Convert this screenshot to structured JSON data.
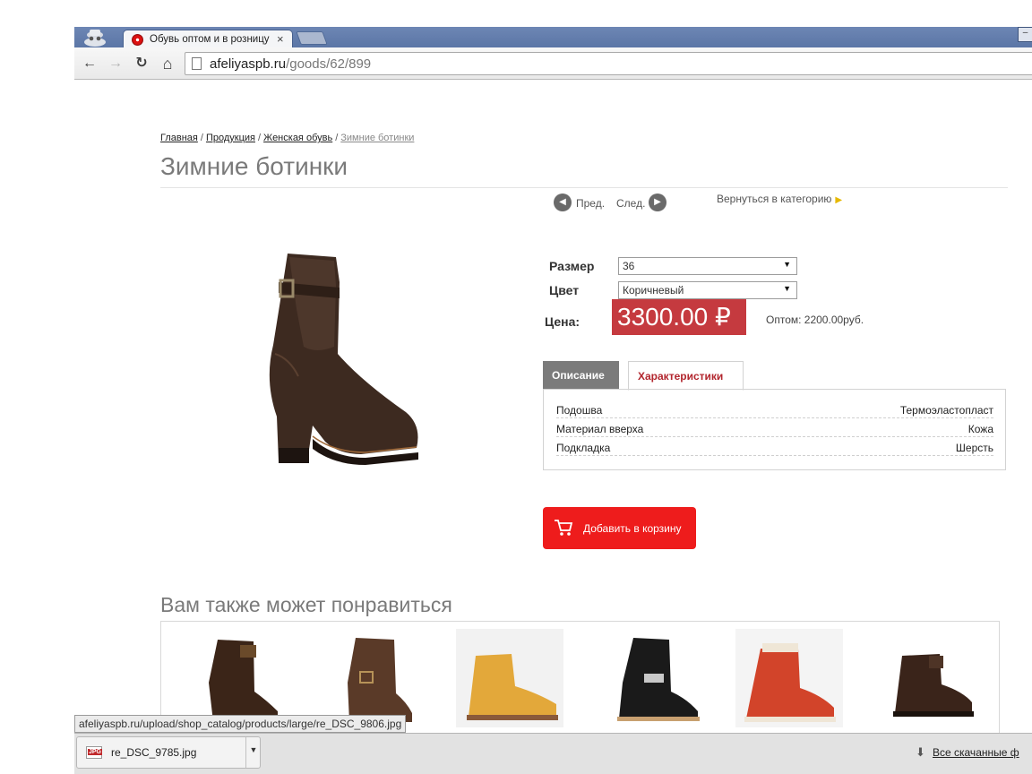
{
  "browser": {
    "tab_title": "Обувь оптом и в розницу",
    "tab_close": "×",
    "url_host": "afeliyaspb.ru",
    "url_path": "/goods/62/899",
    "nav": {
      "back": "←",
      "forward": "→",
      "reload": "↻",
      "home": "⌂"
    },
    "window_control": "–"
  },
  "breadcrumb": {
    "items": [
      "Главная",
      "Продукция",
      "Женская обувь"
    ],
    "current": "Зимние ботинки",
    "separator": "/"
  },
  "product": {
    "title": "Зимние ботинки",
    "prev_label": "Пред.",
    "next_label": "След.",
    "back_to_category": "Вернуться в категорию",
    "size_label": "Размер",
    "size_value": "36",
    "color_label": "Цвет",
    "color_value": "Коричневый",
    "price_label": "Цена:",
    "price_value": "3300.00 ₽",
    "wholesale": "Оптом: 2200.00руб.",
    "tabs": [
      "Описание",
      "Характеристики"
    ],
    "active_tab": "Характеристики",
    "specs": [
      {
        "key": "Подошва",
        "value": "Термоэластопласт"
      },
      {
        "key": "Материал вверха",
        "value": "Кожа"
      },
      {
        "key": "Подкладка",
        "value": "Шерсть"
      }
    ],
    "add_to_cart": "Добавить в корзину"
  },
  "related": {
    "title": "Вам также может понравиться"
  },
  "status_url": "afeliyaspb.ru/upload/shop_catalog/products/large/re_DSC_9806.jpg",
  "downloads": {
    "file_name": "re_DSC_9785.jpg",
    "file_type": "JPG",
    "all_label": "Все скачанные ф"
  },
  "colors": {
    "price_bg": "#c53a3f",
    "cart_bg": "#ee1c1c",
    "active_tab_text": "#b2262e",
    "arrow_accent": "#e6b800"
  }
}
